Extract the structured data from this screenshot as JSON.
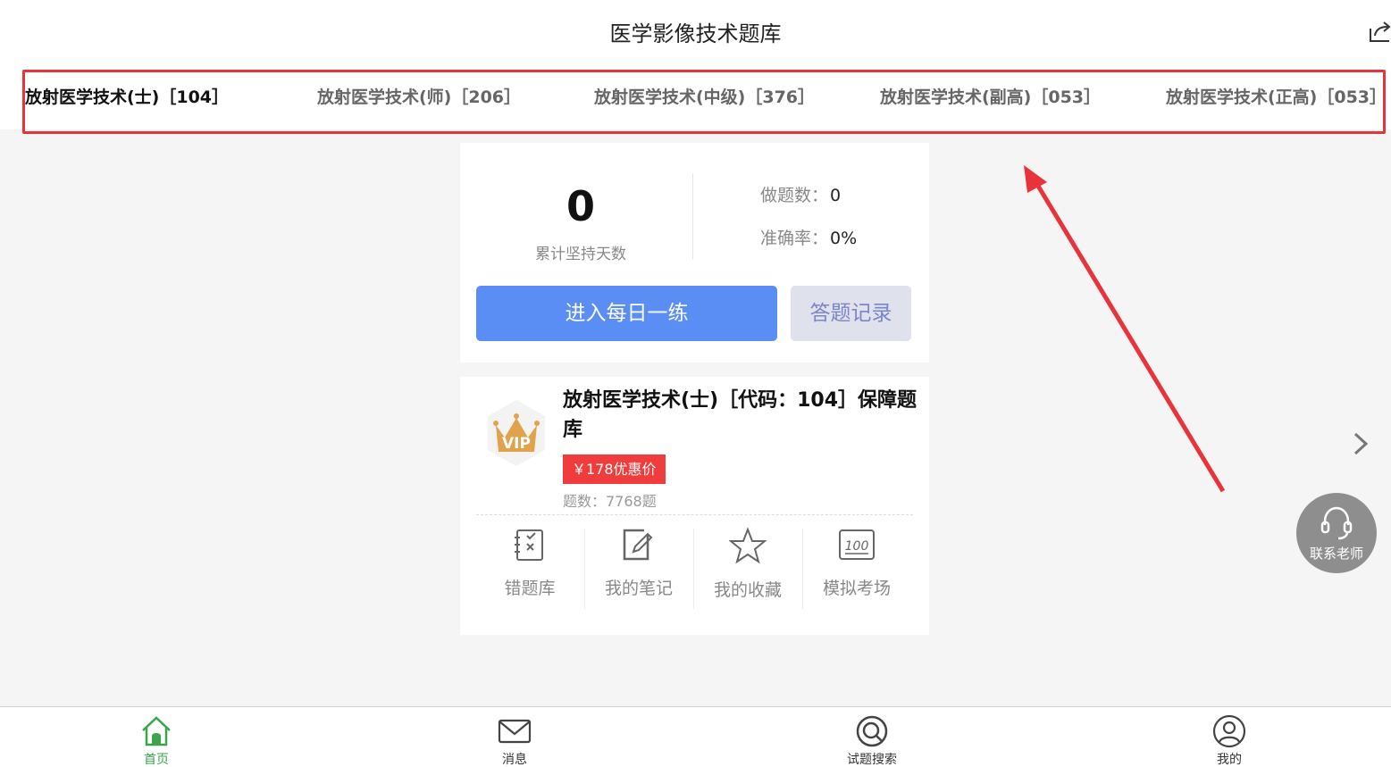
{
  "header": {
    "title": "医学影像技术题库"
  },
  "tabs": [
    {
      "label": "放射医学技术(士)［104］",
      "active": true
    },
    {
      "label": "放射医学技术(师)［206］",
      "active": false
    },
    {
      "label": "放射医学技术(中级)［376］",
      "active": false
    },
    {
      "label": "放射医学技术(副高)［053］",
      "active": false
    },
    {
      "label": "放射医学技术(正高)［053］",
      "active": false
    }
  ],
  "stats": {
    "days_value": "0",
    "days_label": "累计坚持天数",
    "done_label": "做题数：",
    "done_value": "0",
    "accuracy_label": "准确率：",
    "accuracy_value": "0%",
    "practice_button": "进入每日一练",
    "record_button": "答题记录"
  },
  "product": {
    "badge_text": "VIP",
    "title": "放射医学技术(士)［代码：104］保障题库",
    "price": "￥178优惠价",
    "count": "题数：7768题",
    "tools": [
      {
        "label": "错题库",
        "icon": "wrong-book-icon"
      },
      {
        "label": "我的笔记",
        "icon": "note-icon"
      },
      {
        "label": "我的收藏",
        "icon": "star-icon"
      },
      {
        "label": "模拟考场",
        "icon": "exam-100-icon"
      }
    ]
  },
  "contact": {
    "label": "联系老师"
  },
  "bottom_nav": [
    {
      "label": "首页",
      "active": true,
      "icon": "home-icon"
    },
    {
      "label": "消息",
      "active": false,
      "icon": "mail-icon"
    },
    {
      "label": "试题搜索",
      "active": false,
      "icon": "search-icon"
    },
    {
      "label": "我的",
      "active": false,
      "icon": "user-icon"
    }
  ],
  "colors": {
    "primary": "#5b8ef5",
    "price": "#f03c3c",
    "nav_active": "#3aa54a",
    "highlight_box": "#e8333b"
  }
}
